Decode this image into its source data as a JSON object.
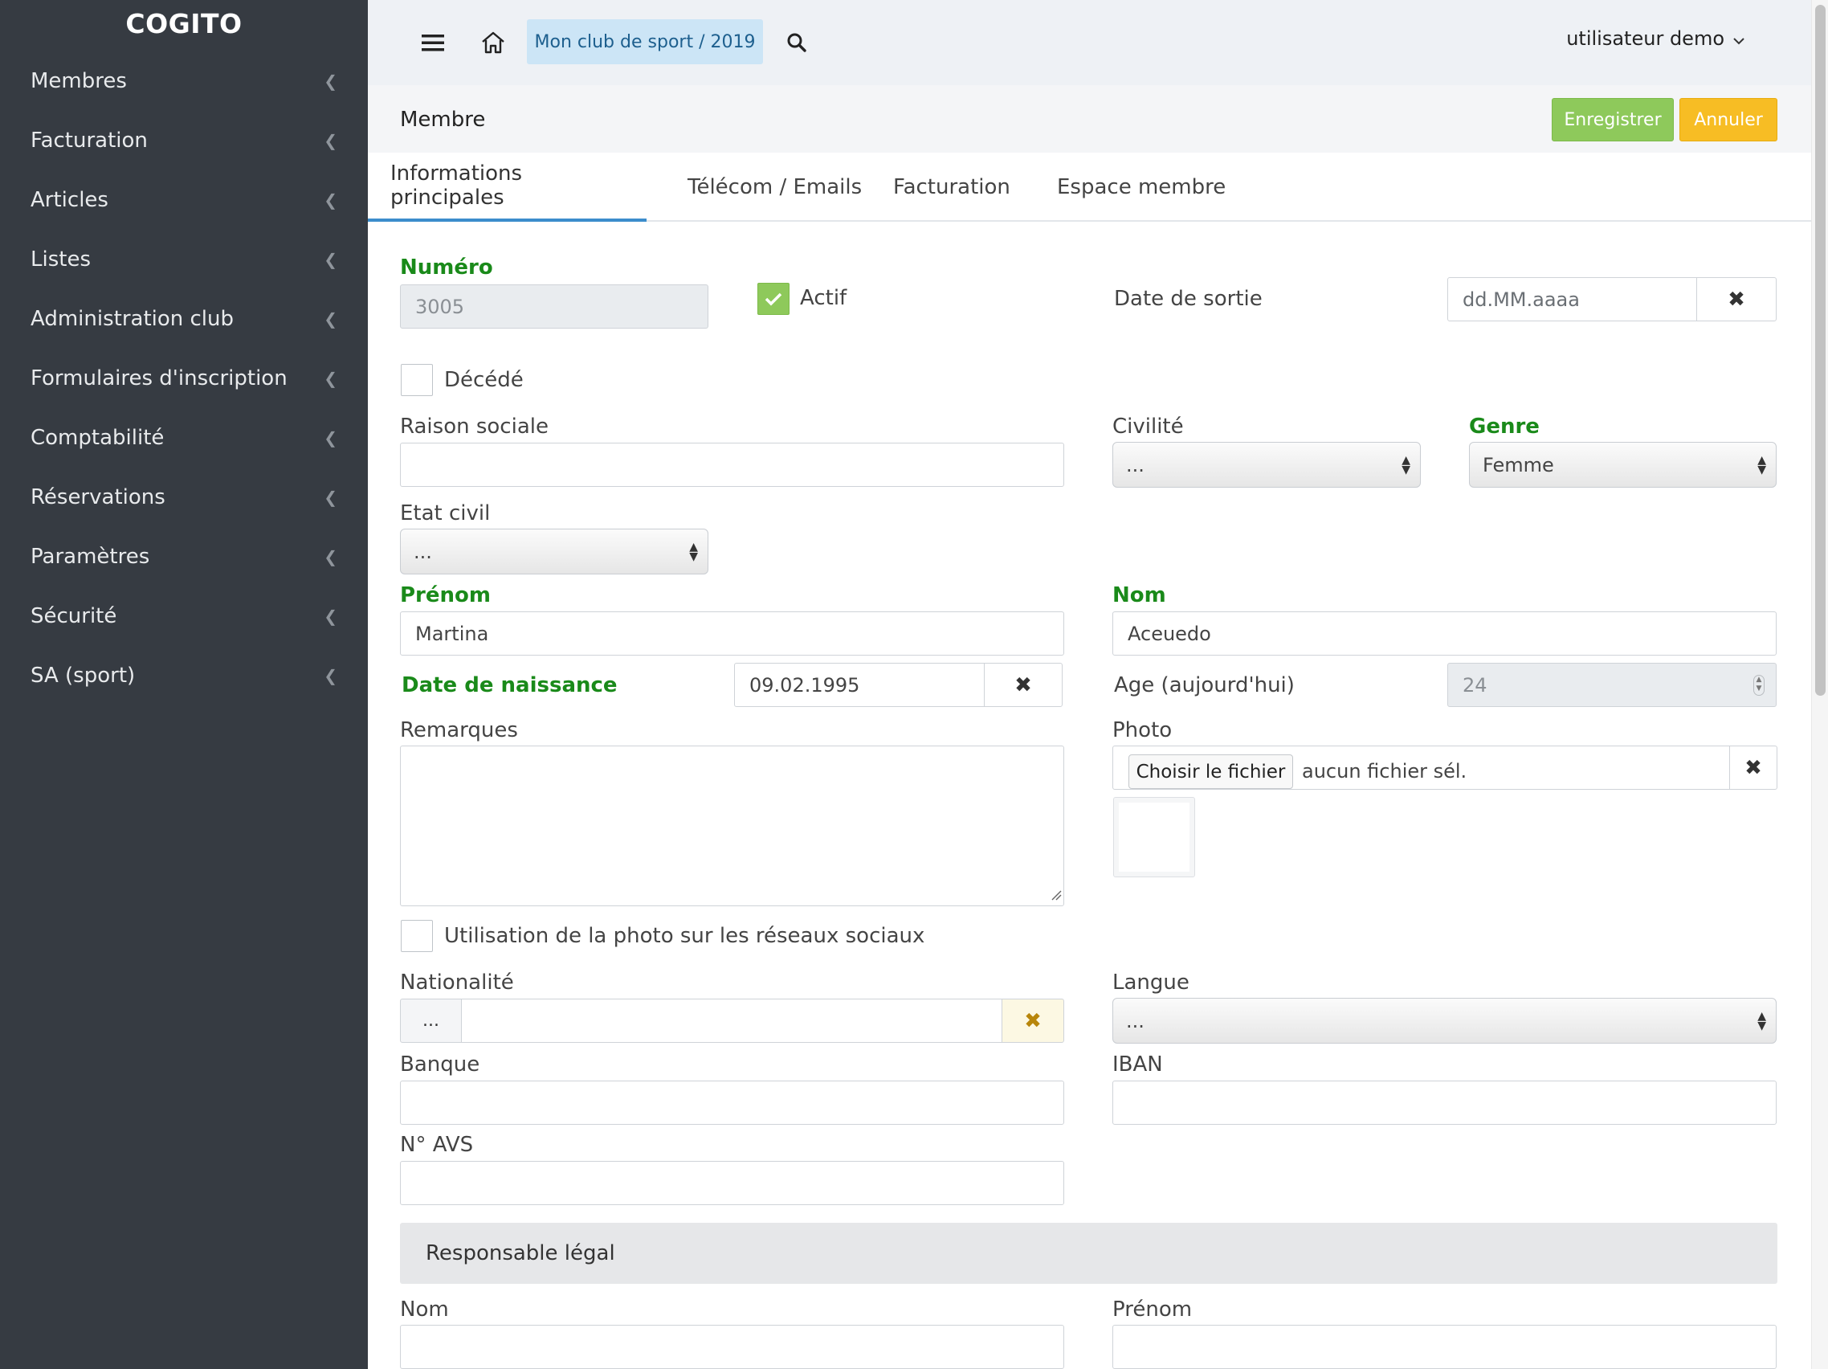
{
  "sidebar": {
    "brand": "COGITO",
    "items": [
      {
        "label": "Membres"
      },
      {
        "label": "Facturation"
      },
      {
        "label": "Articles"
      },
      {
        "label": "Listes"
      },
      {
        "label": "Administration club"
      },
      {
        "label": "Formulaires d'inscription"
      },
      {
        "label": "Comptabilité"
      },
      {
        "label": "Réservations"
      },
      {
        "label": "Paramètres"
      },
      {
        "label": "Sécurité"
      },
      {
        "label": "SA (sport)"
      }
    ]
  },
  "topbar": {
    "club": "Mon club de sport / 2019",
    "user": "utilisateur demo"
  },
  "page": {
    "title": "Membre",
    "save_label": "Enregistrer",
    "cancel_label": "Annuler"
  },
  "tabs": [
    {
      "label": "Informations principales",
      "active": true
    },
    {
      "label": "Télécom / Emails"
    },
    {
      "label": "Facturation"
    },
    {
      "label": "Espace membre"
    }
  ],
  "form": {
    "numero": {
      "label": "Numéro",
      "value": "3005"
    },
    "actif": {
      "label": "Actif",
      "checked": true
    },
    "date_sortie": {
      "label": "Date de sortie",
      "placeholder": "dd.MM.aaaa"
    },
    "decede": {
      "label": "Décédé",
      "checked": false
    },
    "raison_sociale": {
      "label": "Raison sociale",
      "value": ""
    },
    "civilite": {
      "label": "Civilité",
      "value": "..."
    },
    "genre": {
      "label": "Genre",
      "value": "Femme"
    },
    "etat_civil": {
      "label": "Etat civil",
      "value": "..."
    },
    "prenom": {
      "label": "Prénom",
      "value": "Martina"
    },
    "nom": {
      "label": "Nom",
      "value": "Aceuedo"
    },
    "date_naissance": {
      "label": "Date de naissance",
      "value": "09.02.1995"
    },
    "age": {
      "label": "Age (aujourd'hui)",
      "value": "24"
    },
    "remarques": {
      "label": "Remarques",
      "value": ""
    },
    "photo": {
      "label": "Photo",
      "button": "Choisir le fichier",
      "status": "aucun fichier sél."
    },
    "photo_social": {
      "label": "Utilisation de la photo sur les réseaux sociaux",
      "checked": false
    },
    "nationalite": {
      "label": "Nationalité",
      "prefix": "...",
      "value": ""
    },
    "langue": {
      "label": "Langue",
      "value": "..."
    },
    "banque": {
      "label": "Banque",
      "value": ""
    },
    "iban": {
      "label": "IBAN",
      "value": ""
    },
    "avs": {
      "label": "N° AVS",
      "value": ""
    }
  },
  "responsable": {
    "title": "Responsable légal",
    "nom_label": "Nom",
    "prenom_label": "Prénom"
  },
  "icons": {
    "menu": "hamburger-icon",
    "home": "home-icon",
    "search": "search-icon",
    "clear": "close-icon",
    "chevron": "chevron-left-icon"
  },
  "colors": {
    "sidebar": "#363b42",
    "save": "#8ec95b",
    "cancel": "#f7bd24",
    "required": "#1a8a1a",
    "tab_active": "#3c8dcc"
  }
}
